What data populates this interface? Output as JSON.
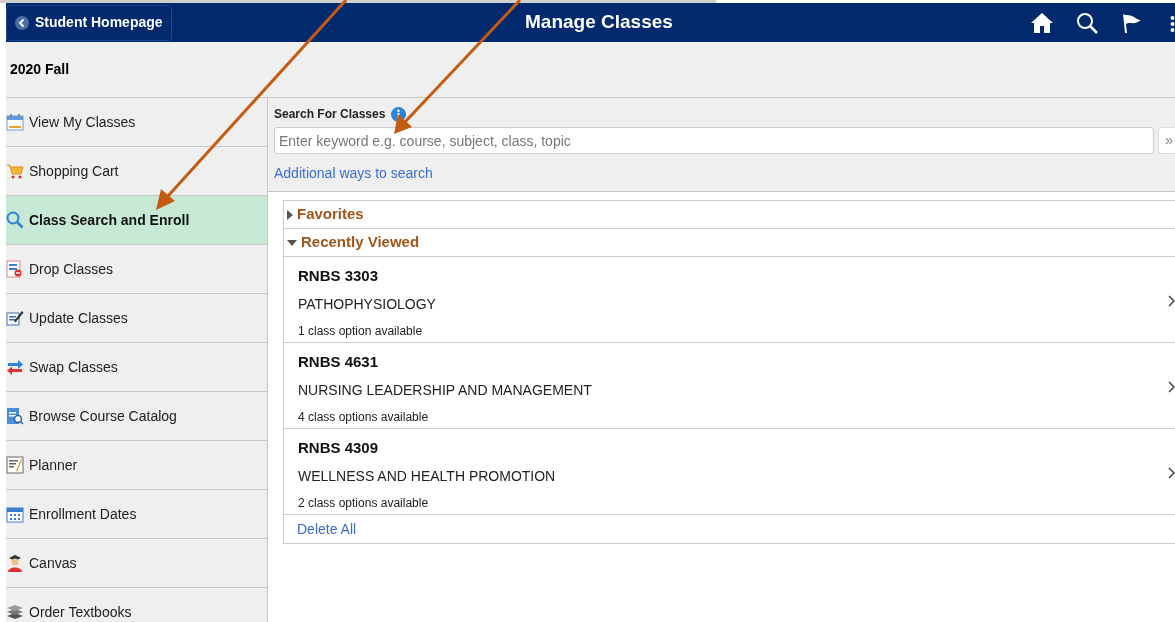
{
  "header": {
    "back_button": "Student Homepage",
    "title": "Manage Classes"
  },
  "term": "2020 Fall",
  "sidebar": {
    "items": [
      {
        "label": "View My Classes",
        "selected": false
      },
      {
        "label": "Shopping Cart",
        "selected": false
      },
      {
        "label": "Class Search and Enroll",
        "selected": true
      },
      {
        "label": "Drop Classes",
        "selected": false
      },
      {
        "label": "Update Classes",
        "selected": false
      },
      {
        "label": "Swap Classes",
        "selected": false
      },
      {
        "label": "Browse Course Catalog",
        "selected": false
      },
      {
        "label": "Planner",
        "selected": false
      },
      {
        "label": "Enrollment Dates",
        "selected": false
      },
      {
        "label": "Canvas",
        "selected": false
      },
      {
        "label": "Order Textbooks",
        "selected": false
      }
    ]
  },
  "search": {
    "label": "Search For Classes",
    "placeholder": "Enter keyword e.g. course, subject, class, topic",
    "button": "»",
    "link": "Additional ways to search"
  },
  "sections": [
    {
      "title": "Favorites",
      "expanded": false
    },
    {
      "title": "Recently Viewed",
      "expanded": true,
      "classes": [
        {
          "code": "RNBS 3303",
          "title": "PATHOPHYSIOLOGY",
          "options": "1 class option available"
        },
        {
          "code": "RNBS 4631",
          "title": "NURSING LEADERSHIP AND MANAGEMENT",
          "options": "4 class options available"
        },
        {
          "code": "RNBS 4309",
          "title": "WELLNESS AND HEALTH PROMOTION",
          "options": "2 class options available"
        }
      ],
      "footer_link": "Delete All"
    }
  ]
}
